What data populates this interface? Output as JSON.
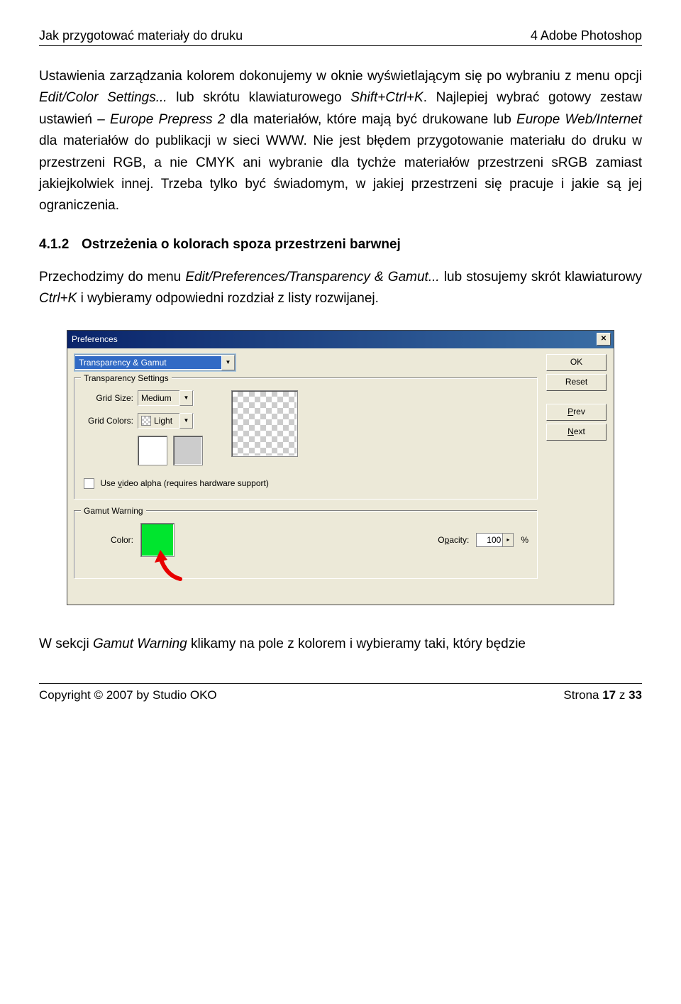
{
  "header": {
    "left": "Jak przygotować materiały do druku",
    "right": "4 Adobe Photoshop"
  },
  "para1_a": "Ustawienia zarządzania kolorem dokonujemy w oknie wyświetlającym się po wybraniu z menu opcji ",
  "para1_it1": "Edit/Color Settings...",
  "para1_b": " lub skrótu klawiaturowego ",
  "para1_it2": "Shift+Ctrl+K",
  "para1_c": ". Najlepiej wybrać gotowy zestaw ustawień – ",
  "para1_it3": "Europe Prepress 2",
  "para1_d": " dla materiałów, które mają być drukowane lub ",
  "para1_it4": "Europe Web/Internet",
  "para1_e": " dla materiałów do publikacji w sieci WWW. Nie jest błędem przygotowanie materiału do druku w przestrzeni RGB, a nie CMYK ani wybranie dla tychże materiałów przestrzeni sRGB zamiast jakiejkolwiek innej. Trzeba tylko być świadomym, w jakiej przestrzeni się pracuje i jakie są jej ograniczenia.",
  "subheading": {
    "num": "4.1.2",
    "txt": "Ostrzeżenia o kolorach spoza przestrzeni barwnej"
  },
  "para2_a": "Przechodzimy do menu ",
  "para2_it1": "Edit/Preferences/Transparency & Gamut...",
  "para2_b": " lub stosujemy skrót klawiaturowy ",
  "para2_it2": "Ctrl+K",
  "para2_c": " i wybieramy odpowiedni rozdział z listy rozwijanej.",
  "dlg": {
    "title": "Preferences",
    "section": "Transparency & Gamut",
    "ts_legend": "Transparency Settings",
    "grid_size_lbl": "Grid Size:",
    "grid_size_val": "Medium",
    "grid_colors_lbl": "Grid Colors:",
    "grid_colors_val": "Light",
    "video_alpha_pre": "Use ",
    "video_alpha_u": "v",
    "video_alpha_post": "ideo alpha (requires hardware support)",
    "gw_legend": "Gamut Warning",
    "color_lbl": "Color:",
    "opacity_lbl_pre": "O",
    "opacity_lbl_u": "p",
    "opacity_lbl_post": "acity:",
    "opacity_val": "100",
    "opacity_unit": "%",
    "buttons": {
      "ok": "OK",
      "reset": "Reset",
      "prev_u": "P",
      "prev_r": "rev",
      "next_u": "N",
      "next_r": "ext"
    }
  },
  "para3_a": "W sekcji ",
  "para3_it1": "Gamut Warning",
  "para3_b": " klikamy na pole z kolorem i wybieramy taki, który będzie",
  "footer": {
    "left": "Copyright © 2007 by Studio OKO",
    "right_a": "Strona ",
    "right_b": "17",
    "right_c": " z ",
    "right_d": "33"
  }
}
